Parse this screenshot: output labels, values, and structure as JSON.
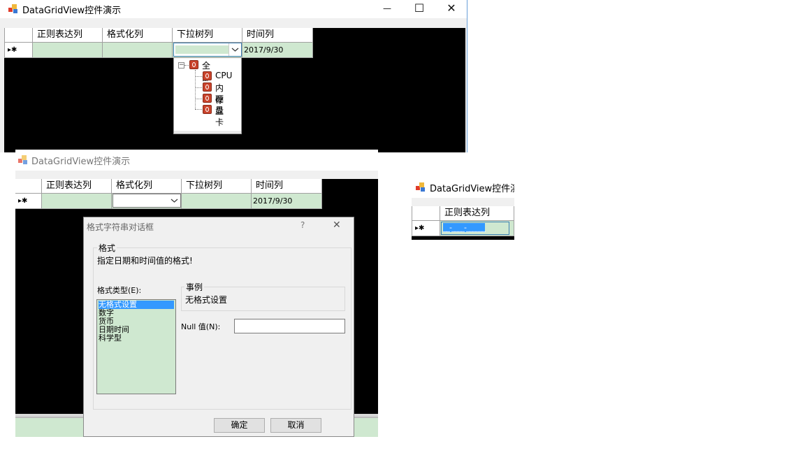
{
  "window1": {
    "title": "DataGridView控件演示",
    "minimize_glyph": "—",
    "maximize_glyph": "☐",
    "close_glyph": "✕",
    "columns": [
      "正则表达列",
      "格式化列",
      "下拉树列",
      "时间列"
    ],
    "row_marker": "▸✱",
    "date_value": "2017/9/30",
    "tree": {
      "root": "全部",
      "children": [
        "CPU",
        "内存",
        "硬盘",
        "显卡"
      ],
      "collapse_glyph": "−"
    }
  },
  "window2": {
    "title": "DataGridView控件演示",
    "columns": [
      "正则表达列",
      "格式化列",
      "下拉树列",
      "时间列"
    ],
    "row_marker": "▸✱",
    "date_value": "2017/9/30",
    "dialog": {
      "title": "格式字符串对话框",
      "help_glyph": "?",
      "close_glyph": "✕",
      "group_label": "格式",
      "description": "指定日期和时间值的格式!",
      "type_label": "格式类型(E):",
      "types": [
        "无格式设置",
        "数字",
        "货币",
        "日期时间",
        "科学型"
      ],
      "sample_label": "事例",
      "sample_value": "无格式设置",
      "null_label": "Null 值(N):",
      "null_value": "",
      "ok_label": "确定",
      "cancel_label": "取消"
    }
  },
  "window3": {
    "title": "DataGridView控件演示",
    "column": "正则表达列",
    "row_marker": "▸✱",
    "mask_value": "__-____-______"
  },
  "colors": {
    "row_bg": "#cfe8d0",
    "selection": "#3399ff",
    "grid_bg": "#000000"
  }
}
